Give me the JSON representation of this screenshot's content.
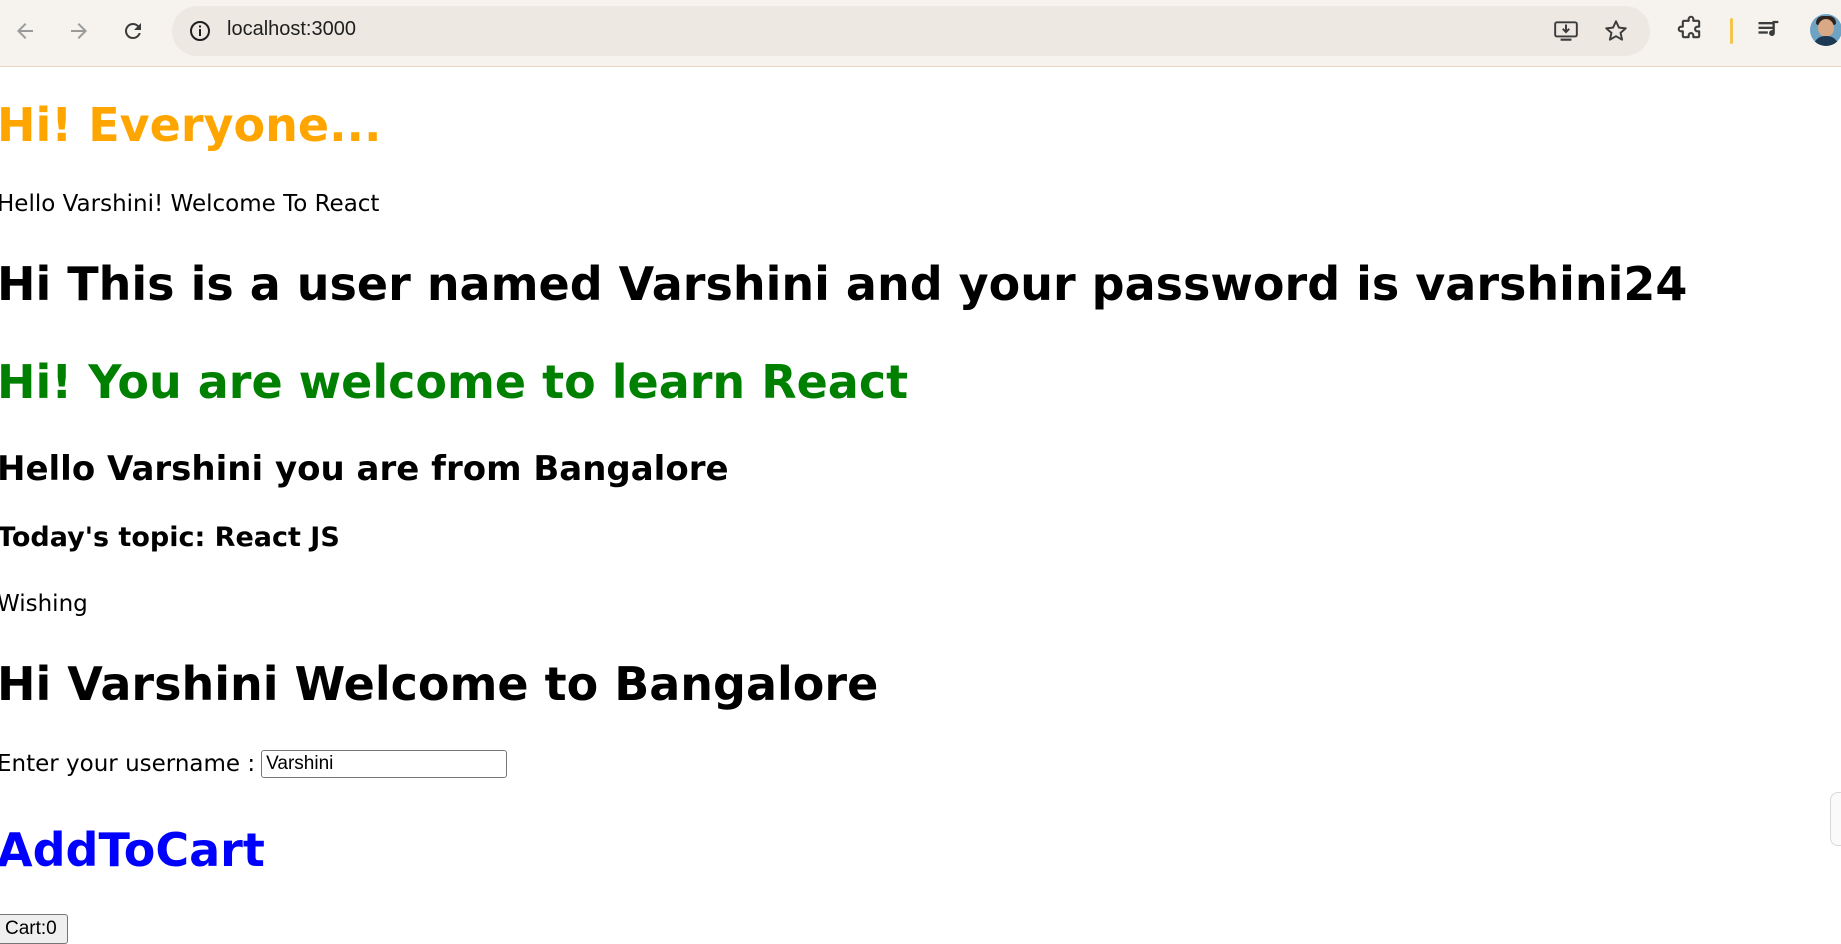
{
  "browser": {
    "url": "localhost:3000"
  },
  "page": {
    "heading_orange": "Hi! Everyone...",
    "greeting": "Hello Varshini! Welcome To React",
    "user_heading": "Hi This is a user named Varshini and your password is varshini24",
    "green_heading": "Hi! You are welcome to learn React",
    "from_heading": "Hello Varshini you are from Bangalore",
    "topic_heading": "Today's topic: React JS",
    "wishing": "Wishing",
    "welcome_heading": "Hi Varshini Welcome to Bangalore",
    "username_label": "Enter your username :",
    "username_value": "Varshini",
    "cart_heading": "AddToCart",
    "cart_button": "Cart:0"
  },
  "colors": {
    "orange": "#ffa500",
    "green": "#008000",
    "blue": "#0000ff"
  },
  "icons": [
    "back-arrow-icon",
    "forward-arrow-icon",
    "reload-icon",
    "site-info-icon",
    "install-app-icon",
    "bookmark-star-icon",
    "extensions-icon",
    "media-queue-icon",
    "profile-avatar"
  ]
}
